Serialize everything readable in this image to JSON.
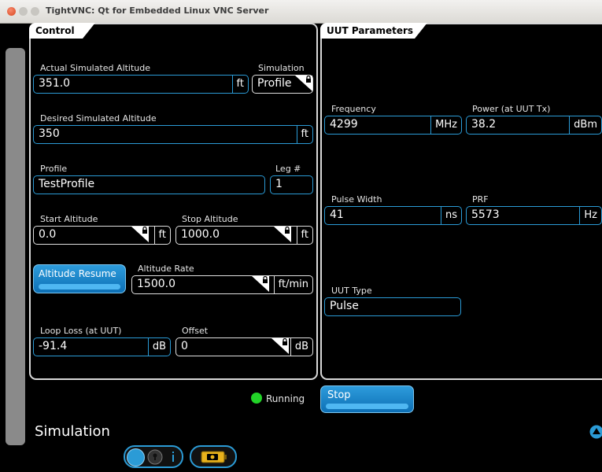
{
  "window": {
    "title": "TightVNC: Qt for Embedded Linux VNC Server"
  },
  "control": {
    "tab_label": "Control",
    "actual_alt": {
      "label": "Actual Simulated Altitude",
      "value": "351.0",
      "unit": "ft"
    },
    "simulation": {
      "label": "Simulation",
      "value": "Profile"
    },
    "desired_alt": {
      "label": "Desired Simulated Altitude",
      "value": "350",
      "unit": "ft"
    },
    "profile": {
      "label": "Profile",
      "value": "TestProfile"
    },
    "leg": {
      "label": "Leg #",
      "value": "1"
    },
    "start_alt": {
      "label": "Start Altitude",
      "value": "0.0",
      "unit": "ft"
    },
    "stop_alt": {
      "label": "Stop Altitude",
      "value": "1000.0",
      "unit": "ft"
    },
    "altitude_resume": {
      "label": "Altitude Resume"
    },
    "alt_rate": {
      "label": "Altitude Rate",
      "value": "1500.0",
      "unit": "ft/min"
    },
    "loop_loss": {
      "label": "Loop Loss (at UUT)",
      "value": "-91.4",
      "unit": "dB"
    },
    "offset": {
      "label": "Offset",
      "value": "0",
      "unit": "dB"
    }
  },
  "uut": {
    "tab_label": "UUT Parameters",
    "frequency": {
      "label": "Frequency",
      "value": "4299",
      "unit": "MHz"
    },
    "power": {
      "label": "Power (at UUT Tx)",
      "value": "38.2",
      "unit": "dBm"
    },
    "pulse_width": {
      "label": "Pulse Width",
      "value": "41",
      "unit": "ns"
    },
    "prf": {
      "label": "PRF",
      "value": "5573",
      "unit": "Hz"
    },
    "uut_type": {
      "label": "UUT Type",
      "value": "Pulse"
    }
  },
  "status": {
    "text": "Running",
    "color": "#22d428"
  },
  "stop_button": {
    "label": "Stop"
  },
  "bottom": {
    "title": "Simulation"
  },
  "colors": {
    "accent": "#2b9bd6",
    "button": "#1680c8"
  }
}
